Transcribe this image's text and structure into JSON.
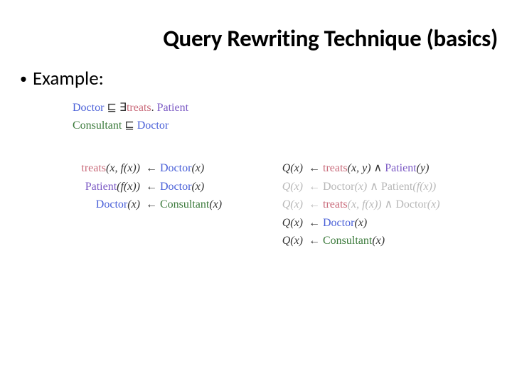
{
  "title": "Query Rewriting Technique (basics)",
  "bullet": "Example:",
  "labels": {
    "doctor": "Doctor",
    "patient": "Patient",
    "treats": "treats",
    "consultant": "Consultant"
  },
  "sym": {
    "sqsubseteq": "⊑",
    "exists": "∃",
    "dot": ".",
    "larr": "←",
    "land": "∧"
  },
  "axioms": [
    {
      "lhs": "Doctor",
      "op": "⊑",
      "rhs_pre": "∃",
      "rhs_role": "treats",
      "dot": ".",
      "rhs_post": "Patient"
    },
    {
      "lhs": "Consultant",
      "op": "⊑",
      "rhs": "Doctor"
    }
  ],
  "left_rules": [
    {
      "head_role": "treats",
      "head_args": "(x, f(x))",
      "arrow": "←",
      "body": "Doctor",
      "body_args": "(x)"
    },
    {
      "head_role": "Patient",
      "head_args": "(f(x))",
      "arrow": "←",
      "body": "Doctor",
      "body_args": "(x)"
    },
    {
      "head_role": "Doctor",
      "head_args": "(x)",
      "arrow": "←",
      "body": "Consultant",
      "body_args": "(x)"
    }
  ],
  "right_rules": [
    {
      "q": "Q(x)",
      "arrow": "←",
      "a": "treats",
      "a_args": "(x, y)",
      "and": "∧",
      "b": "Patient",
      "b_args": "(y)"
    },
    {
      "q": "Q(x)",
      "arrow": "←",
      "a": "Doctor",
      "a_args": "(x)",
      "and": "∧",
      "b": "Patient",
      "b_args": "(f(x))",
      "faded": true
    },
    {
      "q": "Q(x)",
      "arrow": "←",
      "a": "treats",
      "a_args": "(x, f(x))",
      "and": "∧",
      "b": "Doctor",
      "b_args": "(x)",
      "faded": true,
      "a_faded": true
    },
    {
      "q": "Q(x)",
      "arrow": "←",
      "a": "Doctor",
      "a_args": "(x)"
    },
    {
      "q": "Q(x)",
      "arrow": "←",
      "a": "Consultant",
      "a_args": "(x)"
    }
  ]
}
